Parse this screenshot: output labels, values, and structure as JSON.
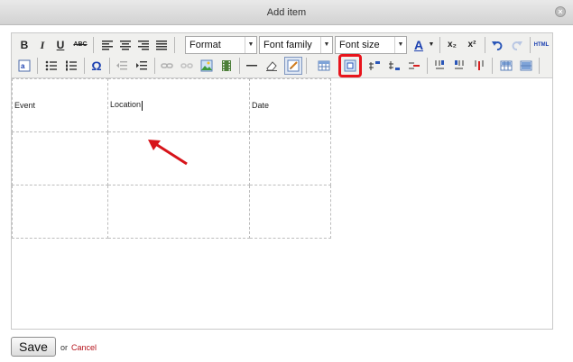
{
  "dialog": {
    "title": "Add item",
    "close_glyph": "×"
  },
  "toolbar": {
    "row1": {
      "bold": "B",
      "italic": "I",
      "underline": "U",
      "strike": "ABC",
      "format_label": "Format",
      "font_family_label": "Font family",
      "font_size_label": "Font size",
      "text_color_glyph": "A",
      "subscript": "x₂",
      "superscript": "x²",
      "html": "HTML"
    },
    "row2": {
      "special_char": "Ω"
    }
  },
  "table": {
    "rows": [
      [
        "Event",
        "Location",
        "Date"
      ],
      [
        "",
        "",
        ""
      ],
      [
        "",
        "",
        ""
      ]
    ]
  },
  "footer": {
    "save_label": "Save",
    "or_text": "or",
    "cancel_label": "Cancel"
  },
  "colors": {
    "highlight": "#e8141c",
    "arrow": "#d7141a",
    "cancel_link": "#b5121b",
    "text_color": "#1a3fb0"
  }
}
